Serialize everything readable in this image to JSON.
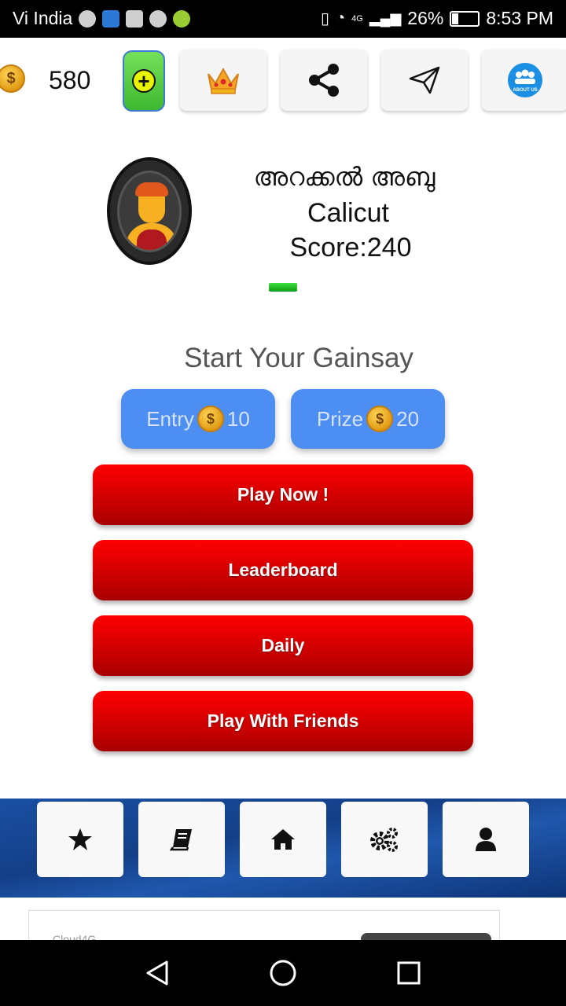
{
  "status_bar": {
    "carrier": "Vi India",
    "network": "4G",
    "battery": "26%",
    "battery_level": 0.26,
    "time": "8:53 PM"
  },
  "toolbar": {
    "coin_count": "580",
    "coin_symbol": "$",
    "icons": [
      "coin-icon",
      "add-coins-icon",
      "crown-icon",
      "share-icon",
      "send-icon",
      "about-us-icon"
    ],
    "about_us_label": "ABOUT US"
  },
  "profile": {
    "name": "അറക്കൽ അബു",
    "place": "Calicut",
    "score": "Score:240"
  },
  "gainsay": {
    "title": "Start Your Gainsay",
    "entry_label": "Entry",
    "entry_value": "10",
    "prize_label": "Prize",
    "prize_value": "20"
  },
  "buttons": {
    "play_now": "Play Now !",
    "leaderboard": "Leaderboard",
    "daily": "Daily",
    "play_with_friends": "Play With Friends"
  },
  "bottom_nav": {
    "items": [
      "star-icon",
      "book-icon",
      "home-icon",
      "settings-icon",
      "user-icon"
    ]
  },
  "ad": {
    "label": "Cloud4G"
  },
  "colors": {
    "accent_blue": "#4d8ef2",
    "button_red": "#e00000",
    "nav_blue": "#1a4fa2",
    "add_green": "#4cc43a"
  }
}
